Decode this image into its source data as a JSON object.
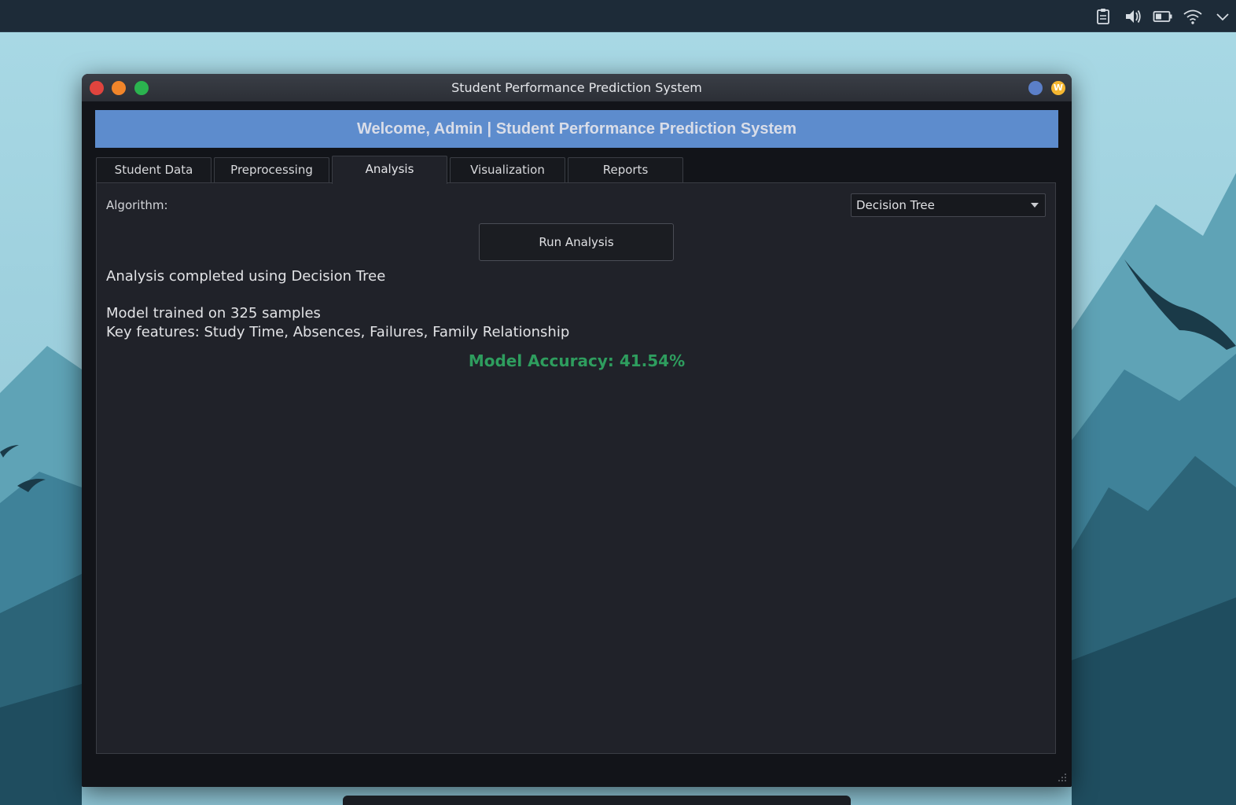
{
  "window": {
    "title": "Student Performance Prediction System",
    "badge": "W"
  },
  "banner": {
    "text": "Welcome, Admin | Student Performance Prediction System"
  },
  "tabs": [
    {
      "label": "Student Data",
      "active": false
    },
    {
      "label": "Preprocessing",
      "active": false
    },
    {
      "label": "Analysis",
      "active": true
    },
    {
      "label": "Visualization",
      "active": false
    },
    {
      "label": "Reports",
      "active": false
    }
  ],
  "analysis": {
    "algorithm_label": "Algorithm:",
    "algorithm_selected": "Decision Tree",
    "run_button": "Run Analysis",
    "status": "Analysis completed using Decision Tree",
    "samples": "Model trained on 325 samples",
    "features": "Key features: Study Time, Absences, Failures, Family Relationship",
    "accuracy": "Model Accuracy: 41.54%"
  },
  "tray": {
    "icons": [
      "clipboard-icon",
      "volume-icon",
      "battery-icon",
      "wifi-icon",
      "chevron-down-icon"
    ]
  },
  "colors": {
    "banner": "#5d8ccd",
    "accuracy": "#2e9d5e",
    "panel": "#202229",
    "top_panel": "#1d2b38"
  }
}
